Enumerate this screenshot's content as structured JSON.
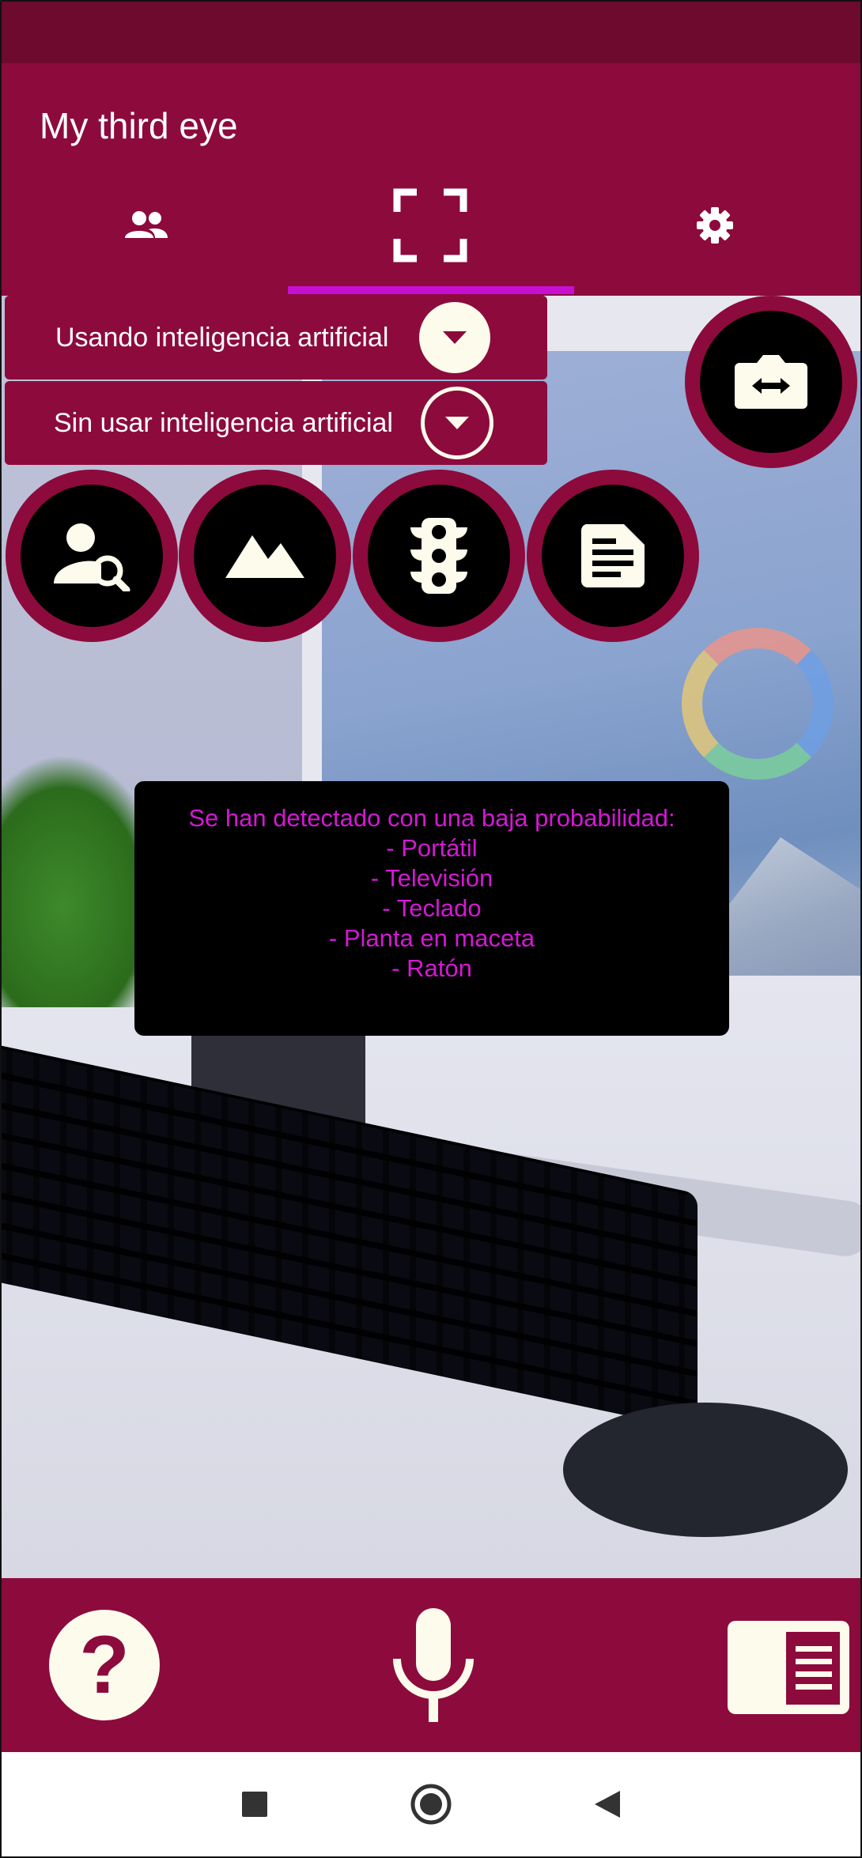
{
  "app": {
    "title": "My third eye"
  },
  "tabs": [
    {
      "icon": "people-icon"
    },
    {
      "icon": "scan-frame-icon",
      "selected": true
    },
    {
      "icon": "gear-icon"
    }
  ],
  "ai_modes": {
    "with_ai_label": "Usando inteligencia artificial",
    "without_ai_label": "Sin usar inteligencia artificial"
  },
  "detection": {
    "heading": "Se han detectado con una baja probabilidad:",
    "items": [
      "- Portátil",
      "- Televisión",
      "- Teclado",
      "- Planta en maceta",
      "- Ratón"
    ]
  },
  "colors": {
    "primary": "#8c0b3c",
    "status_bar": "#6d0a2e",
    "tab_indicator": "#c70fd4",
    "result_text": "#d418d4",
    "icon_light": "#fdfbec"
  }
}
